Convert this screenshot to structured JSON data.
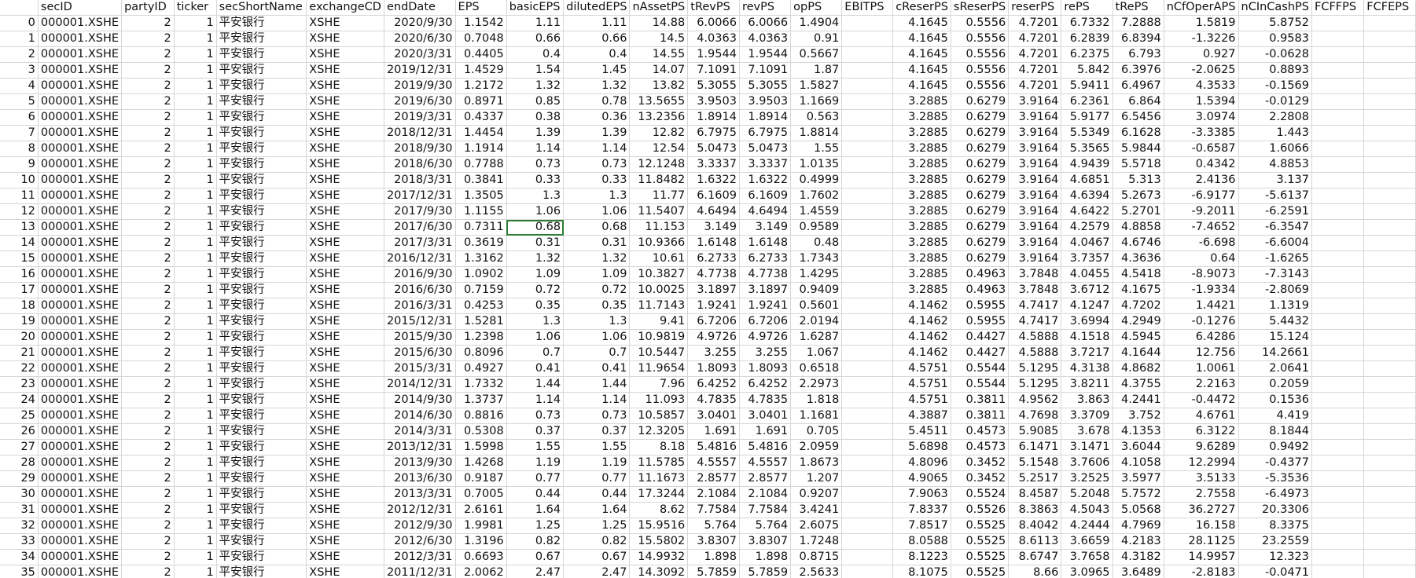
{
  "columns": [
    "",
    "secID",
    "partyID",
    "ticker",
    "secShortName",
    "exchangeCD",
    "endDate",
    "EPS",
    "basicEPS",
    "dilutedEPS",
    "nAssetPS",
    "tRevPS",
    "revPS",
    "opPS",
    "EBITPS",
    "cReserPS",
    "sReserPS",
    "reserPS",
    "rePS",
    "tRePS",
    "nCfOperAPS",
    "nCInCashPS",
    "FCFFPS",
    "FCFEPS"
  ],
  "rows": [
    [
      "0",
      "000001.XSHE",
      "2",
      "1",
      "平安银行",
      "XSHE",
      "2020/9/30",
      "1.1542",
      "1.11",
      "1.11",
      "14.88",
      "6.0066",
      "6.0066",
      "1.4904",
      "",
      "4.1645",
      "0.5556",
      "4.7201",
      "6.7332",
      "7.2888",
      "1.5819",
      "5.8752",
      "",
      ""
    ],
    [
      "1",
      "000001.XSHE",
      "2",
      "1",
      "平安银行",
      "XSHE",
      "2020/6/30",
      "0.7048",
      "0.66",
      "0.66",
      "14.5",
      "4.0363",
      "4.0363",
      "0.91",
      "",
      "4.1645",
      "0.5556",
      "4.7201",
      "6.2839",
      "6.8394",
      "-1.3226",
      "0.9583",
      "",
      ""
    ],
    [
      "2",
      "000001.XSHE",
      "2",
      "1",
      "平安银行",
      "XSHE",
      "2020/3/31",
      "0.4405",
      "0.4",
      "0.4",
      "14.55",
      "1.9544",
      "1.9544",
      "0.5667",
      "",
      "4.1645",
      "0.5556",
      "4.7201",
      "6.2375",
      "6.793",
      "0.927",
      "-0.0628",
      "",
      ""
    ],
    [
      "3",
      "000001.XSHE",
      "2",
      "1",
      "平安银行",
      "XSHE",
      "2019/12/31",
      "1.4529",
      "1.54",
      "1.45",
      "14.07",
      "7.1091",
      "7.1091",
      "1.87",
      "",
      "4.1645",
      "0.5556",
      "4.7201",
      "5.842",
      "6.3976",
      "-2.0625",
      "0.8893",
      "",
      ""
    ],
    [
      "4",
      "000001.XSHE",
      "2",
      "1",
      "平安银行",
      "XSHE",
      "2019/9/30",
      "1.2172",
      "1.32",
      "1.32",
      "13.82",
      "5.3055",
      "5.3055",
      "1.5827",
      "",
      "4.1645",
      "0.5556",
      "4.7201",
      "5.9411",
      "6.4967",
      "4.3533",
      "-0.1569",
      "",
      ""
    ],
    [
      "5",
      "000001.XSHE",
      "2",
      "1",
      "平安银行",
      "XSHE",
      "2019/6/30",
      "0.8971",
      "0.85",
      "0.78",
      "13.5655",
      "3.9503",
      "3.9503",
      "1.1669",
      "",
      "3.2885",
      "0.6279",
      "3.9164",
      "6.2361",
      "6.864",
      "1.5394",
      "-0.0129",
      "",
      ""
    ],
    [
      "6",
      "000001.XSHE",
      "2",
      "1",
      "平安银行",
      "XSHE",
      "2019/3/31",
      "0.4337",
      "0.38",
      "0.36",
      "13.2356",
      "1.8914",
      "1.8914",
      "0.563",
      "",
      "3.2885",
      "0.6279",
      "3.9164",
      "5.9177",
      "6.5456",
      "3.0974",
      "2.2808",
      "",
      ""
    ],
    [
      "7",
      "000001.XSHE",
      "2",
      "1",
      "平安银行",
      "XSHE",
      "2018/12/31",
      "1.4454",
      "1.39",
      "1.39",
      "12.82",
      "6.7975",
      "6.7975",
      "1.8814",
      "",
      "3.2885",
      "0.6279",
      "3.9164",
      "5.5349",
      "6.1628",
      "-3.3385",
      "1.443",
      "",
      ""
    ],
    [
      "8",
      "000001.XSHE",
      "2",
      "1",
      "平安银行",
      "XSHE",
      "2018/9/30",
      "1.1914",
      "1.14",
      "1.14",
      "12.54",
      "5.0473",
      "5.0473",
      "1.55",
      "",
      "3.2885",
      "0.6279",
      "3.9164",
      "5.3565",
      "5.9844",
      "-0.6587",
      "1.6066",
      "",
      ""
    ],
    [
      "9",
      "000001.XSHE",
      "2",
      "1",
      "平安银行",
      "XSHE",
      "2018/6/30",
      "0.7788",
      "0.73",
      "0.73",
      "12.1248",
      "3.3337",
      "3.3337",
      "1.0135",
      "",
      "3.2885",
      "0.6279",
      "3.9164",
      "4.9439",
      "5.5718",
      "0.4342",
      "4.8853",
      "",
      ""
    ],
    [
      "10",
      "000001.XSHE",
      "2",
      "1",
      "平安银行",
      "XSHE",
      "2018/3/31",
      "0.3841",
      "0.33",
      "0.33",
      "11.8482",
      "1.6322",
      "1.6322",
      "0.4999",
      "",
      "3.2885",
      "0.6279",
      "3.9164",
      "4.6851",
      "5.313",
      "2.4136",
      "3.137",
      "",
      ""
    ],
    [
      "11",
      "000001.XSHE",
      "2",
      "1",
      "平安银行",
      "XSHE",
      "2017/12/31",
      "1.3505",
      "1.3",
      "1.3",
      "11.77",
      "6.1609",
      "6.1609",
      "1.7602",
      "",
      "3.2885",
      "0.6279",
      "3.9164",
      "4.6394",
      "5.2673",
      "-6.9177",
      "-5.6137",
      "",
      ""
    ],
    [
      "12",
      "000001.XSHE",
      "2",
      "1",
      "平安银行",
      "XSHE",
      "2017/9/30",
      "1.1155",
      "1.06",
      "1.06",
      "11.5407",
      "4.6494",
      "4.6494",
      "1.4559",
      "",
      "3.2885",
      "0.6279",
      "3.9164",
      "4.6422",
      "5.2701",
      "-9.2011",
      "-6.2591",
      "",
      ""
    ],
    [
      "13",
      "000001.XSHE",
      "2",
      "1",
      "平安银行",
      "XSHE",
      "2017/6/30",
      "0.7311",
      "0.68",
      "0.68",
      "11.153",
      "3.149",
      "3.149",
      "0.9589",
      "",
      "3.2885",
      "0.6279",
      "3.9164",
      "4.2579",
      "4.8858",
      "-7.4652",
      "-6.3547",
      "",
      ""
    ],
    [
      "14",
      "000001.XSHE",
      "2",
      "1",
      "平安银行",
      "XSHE",
      "2017/3/31",
      "0.3619",
      "0.31",
      "0.31",
      "10.9366",
      "1.6148",
      "1.6148",
      "0.48",
      "",
      "3.2885",
      "0.6279",
      "3.9164",
      "4.0467",
      "4.6746",
      "-6.698",
      "-6.6004",
      "",
      ""
    ],
    [
      "15",
      "000001.XSHE",
      "2",
      "1",
      "平安银行",
      "XSHE",
      "2016/12/31",
      "1.3162",
      "1.32",
      "1.32",
      "10.61",
      "6.2733",
      "6.2733",
      "1.7343",
      "",
      "3.2885",
      "0.6279",
      "3.9164",
      "3.7357",
      "4.3636",
      "0.64",
      "-1.6265",
      "",
      ""
    ],
    [
      "16",
      "000001.XSHE",
      "2",
      "1",
      "平安银行",
      "XSHE",
      "2016/9/30",
      "1.0902",
      "1.09",
      "1.09",
      "10.3827",
      "4.7738",
      "4.7738",
      "1.4295",
      "",
      "3.2885",
      "0.4963",
      "3.7848",
      "4.0455",
      "4.5418",
      "-8.9073",
      "-7.3143",
      "",
      ""
    ],
    [
      "17",
      "000001.XSHE",
      "2",
      "1",
      "平安银行",
      "XSHE",
      "2016/6/30",
      "0.7159",
      "0.72",
      "0.72",
      "10.0025",
      "3.1897",
      "3.1897",
      "0.9409",
      "",
      "3.2885",
      "0.4963",
      "3.7848",
      "3.6712",
      "4.1675",
      "-1.9334",
      "-2.8069",
      "",
      ""
    ],
    [
      "18",
      "000001.XSHE",
      "2",
      "1",
      "平安银行",
      "XSHE",
      "2016/3/31",
      "0.4253",
      "0.35",
      "0.35",
      "11.7143",
      "1.9241",
      "1.9241",
      "0.5601",
      "",
      "4.1462",
      "0.5955",
      "4.7417",
      "4.1247",
      "4.7202",
      "1.4421",
      "1.1319",
      "",
      ""
    ],
    [
      "19",
      "000001.XSHE",
      "2",
      "1",
      "平安银行",
      "XSHE",
      "2015/12/31",
      "1.5281",
      "1.3",
      "1.3",
      "9.41",
      "6.7206",
      "6.7206",
      "2.0194",
      "",
      "4.1462",
      "0.5955",
      "4.7417",
      "3.6994",
      "4.2949",
      "-0.1276",
      "5.4432",
      "",
      ""
    ],
    [
      "20",
      "000001.XSHE",
      "2",
      "1",
      "平安银行",
      "XSHE",
      "2015/9/30",
      "1.2398",
      "1.06",
      "1.06",
      "10.9819",
      "4.9726",
      "4.9726",
      "1.6287",
      "",
      "4.1462",
      "0.4427",
      "4.5888",
      "4.1518",
      "4.5945",
      "6.4286",
      "15.124",
      "",
      ""
    ],
    [
      "21",
      "000001.XSHE",
      "2",
      "1",
      "平安银行",
      "XSHE",
      "2015/6/30",
      "0.8096",
      "0.7",
      "0.7",
      "10.5447",
      "3.255",
      "3.255",
      "1.067",
      "",
      "4.1462",
      "0.4427",
      "4.5888",
      "3.7217",
      "4.1644",
      "12.756",
      "14.2661",
      "",
      ""
    ],
    [
      "22",
      "000001.XSHE",
      "2",
      "1",
      "平安银行",
      "XSHE",
      "2015/3/31",
      "0.4927",
      "0.41",
      "0.41",
      "11.9654",
      "1.8093",
      "1.8093",
      "0.6518",
      "",
      "4.5751",
      "0.5544",
      "5.1295",
      "4.3138",
      "4.8682",
      "1.0061",
      "2.0641",
      "",
      ""
    ],
    [
      "23",
      "000001.XSHE",
      "2",
      "1",
      "平安银行",
      "XSHE",
      "2014/12/31",
      "1.7332",
      "1.44",
      "1.44",
      "7.96",
      "6.4252",
      "6.4252",
      "2.2973",
      "",
      "4.5751",
      "0.5544",
      "5.1295",
      "3.8211",
      "4.3755",
      "2.2163",
      "0.2059",
      "",
      ""
    ],
    [
      "24",
      "000001.XSHE",
      "2",
      "1",
      "平安银行",
      "XSHE",
      "2014/9/30",
      "1.3737",
      "1.14",
      "1.14",
      "11.093",
      "4.7835",
      "4.7835",
      "1.818",
      "",
      "4.5751",
      "0.3811",
      "4.9562",
      "3.863",
      "4.2441",
      "-0.4472",
      "0.1536",
      "",
      ""
    ],
    [
      "25",
      "000001.XSHE",
      "2",
      "1",
      "平安银行",
      "XSHE",
      "2014/6/30",
      "0.8816",
      "0.73",
      "0.73",
      "10.5857",
      "3.0401",
      "3.0401",
      "1.1681",
      "",
      "4.3887",
      "0.3811",
      "4.7698",
      "3.3709",
      "3.752",
      "4.6761",
      "4.419",
      "",
      ""
    ],
    [
      "26",
      "000001.XSHE",
      "2",
      "1",
      "平安银行",
      "XSHE",
      "2014/3/31",
      "0.5308",
      "0.37",
      "0.37",
      "12.3205",
      "1.691",
      "1.691",
      "0.705",
      "",
      "5.4511",
      "0.4573",
      "5.9085",
      "3.678",
      "4.1353",
      "6.3122",
      "8.1844",
      "",
      ""
    ],
    [
      "27",
      "000001.XSHE",
      "2",
      "1",
      "平安银行",
      "XSHE",
      "2013/12/31",
      "1.5998",
      "1.55",
      "1.55",
      "8.18",
      "5.4816",
      "5.4816",
      "2.0959",
      "",
      "5.6898",
      "0.4573",
      "6.1471",
      "3.1471",
      "3.6044",
      "9.6289",
      "0.9492",
      "",
      ""
    ],
    [
      "28",
      "000001.XSHE",
      "2",
      "1",
      "平安银行",
      "XSHE",
      "2013/9/30",
      "1.4268",
      "1.19",
      "1.19",
      "11.5785",
      "4.5557",
      "4.5557",
      "1.8673",
      "",
      "4.8096",
      "0.3452",
      "5.1548",
      "3.7606",
      "4.1058",
      "12.2994",
      "-0.4377",
      "",
      ""
    ],
    [
      "29",
      "000001.XSHE",
      "2",
      "1",
      "平安银行",
      "XSHE",
      "2013/6/30",
      "0.9187",
      "0.77",
      "0.77",
      "11.1673",
      "2.8577",
      "2.8577",
      "1.207",
      "",
      "4.9065",
      "0.3452",
      "5.2517",
      "3.2525",
      "3.5977",
      "3.5133",
      "-5.3536",
      "",
      ""
    ],
    [
      "30",
      "000001.XSHE",
      "2",
      "1",
      "平安银行",
      "XSHE",
      "2013/3/31",
      "0.7005",
      "0.44",
      "0.44",
      "17.3244",
      "2.1084",
      "2.1084",
      "0.9207",
      "",
      "7.9063",
      "0.5524",
      "8.4587",
      "5.2048",
      "5.7572",
      "2.7558",
      "-6.4973",
      "",
      ""
    ],
    [
      "31",
      "000001.XSHE",
      "2",
      "1",
      "平安银行",
      "XSHE",
      "2012/12/31",
      "2.6161",
      "1.64",
      "1.64",
      "8.62",
      "7.7584",
      "7.7584",
      "3.4241",
      "",
      "7.8337",
      "0.5526",
      "8.3863",
      "4.5043",
      "5.0568",
      "36.2727",
      "20.3306",
      "",
      ""
    ],
    [
      "32",
      "000001.XSHE",
      "2",
      "1",
      "平安银行",
      "XSHE",
      "2012/9/30",
      "1.9981",
      "1.25",
      "1.25",
      "15.9516",
      "5.764",
      "5.764",
      "2.6075",
      "",
      "7.8517",
      "0.5525",
      "8.4042",
      "4.2444",
      "4.7969",
      "16.158",
      "8.3375",
      "",
      ""
    ],
    [
      "33",
      "000001.XSHE",
      "2",
      "1",
      "平安银行",
      "XSHE",
      "2012/6/30",
      "1.3196",
      "0.82",
      "0.82",
      "15.5802",
      "3.8307",
      "3.8307",
      "1.7248",
      "",
      "8.0588",
      "0.5525",
      "8.6113",
      "3.6659",
      "4.2183",
      "28.1125",
      "23.2559",
      "",
      ""
    ],
    [
      "34",
      "000001.XSHE",
      "2",
      "1",
      "平安银行",
      "XSHE",
      "2012/3/31",
      "0.6693",
      "0.67",
      "0.67",
      "14.9932",
      "1.898",
      "1.898",
      "0.8715",
      "",
      "8.1223",
      "0.5525",
      "8.6747",
      "3.7658",
      "4.3182",
      "14.9957",
      "12.323",
      "",
      ""
    ],
    [
      "35",
      "000001.XSHE",
      "2",
      "1",
      "平安银行",
      "XSHE",
      "2011/12/31",
      "2.0062",
      "2.47",
      "2.47",
      "14.3092",
      "5.7859",
      "5.7859",
      "2.5633",
      "",
      "8.1075",
      "0.5525",
      "8.66",
      "3.0965",
      "3.6489",
      "-2.8183",
      "-0.0471",
      "",
      ""
    ]
  ],
  "selected_cell": {
    "row": 13,
    "col": 8
  },
  "colors": {
    "grid": "#d6d6d6",
    "selection": "#2e7d32",
    "background": "#ffffff"
  }
}
